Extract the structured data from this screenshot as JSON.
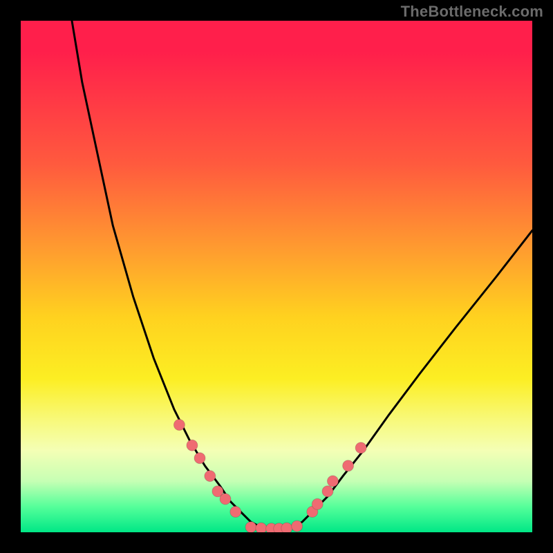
{
  "watermark": "TheBottleneck.com",
  "colors": {
    "frame": "#000000",
    "watermark_text": "#6b6b6b",
    "curve": "#000000",
    "marker": "#ef6b72",
    "gradient_stops": [
      "#ff1f4b",
      "#ff5a3e",
      "#ff9d2f",
      "#ffd21f",
      "#fcee23",
      "#f8f97a",
      "#f4ffb5",
      "#c6ffb4",
      "#55ff9a",
      "#00e786"
    ]
  },
  "chart_data": {
    "type": "line",
    "title": "",
    "xlabel": "",
    "ylabel": "",
    "xlim": [
      0,
      100
    ],
    "ylim": [
      0,
      100
    ],
    "y_axis_inverted_note": "y=0 at top of plot, y=100 at bottom (green)",
    "series": [
      {
        "name": "curve",
        "x": [
          10,
          12,
          15,
          18,
          22,
          26,
          30,
          33,
          36,
          39,
          41,
          43,
          45,
          47,
          49,
          51,
          53,
          55,
          57,
          60,
          63,
          67,
          72,
          78,
          85,
          93,
          100
        ],
        "y": [
          0,
          12,
          26,
          40,
          54,
          66,
          76,
          82,
          87,
          91,
          94,
          96,
          98,
          99,
          99.5,
          99.5,
          99,
          98,
          96,
          93,
          89,
          84,
          77,
          69,
          60,
          50,
          41
        ]
      },
      {
        "name": "markers-left",
        "x": [
          31,
          33.5,
          35,
          37,
          38.5,
          40,
          42
        ],
        "y": [
          79,
          83,
          85.5,
          89,
          92,
          93.5,
          96
        ]
      },
      {
        "name": "markers-bottom",
        "x": [
          45,
          47,
          49,
          50.5,
          52,
          54
        ],
        "y": [
          99,
          99.2,
          99.3,
          99.3,
          99.2,
          98.8
        ]
      },
      {
        "name": "markers-right",
        "x": [
          57,
          58,
          60,
          61,
          64,
          66.5
        ],
        "y": [
          96,
          94.5,
          92,
          90,
          87,
          83.5
        ]
      }
    ]
  }
}
